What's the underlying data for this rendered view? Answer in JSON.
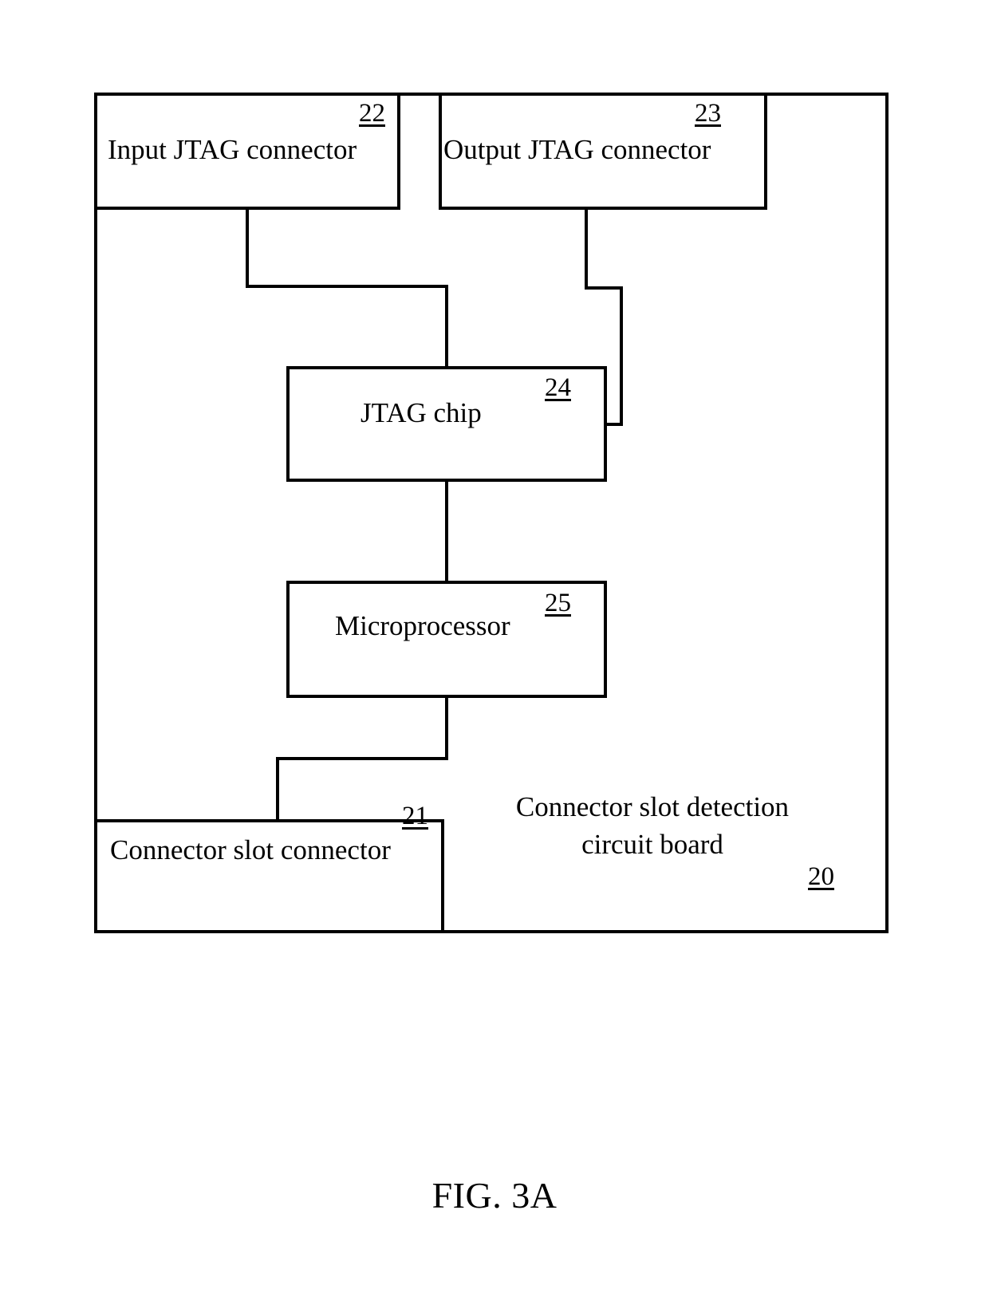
{
  "figure": {
    "caption": "FIG. 3A",
    "board": {
      "name_line1": "Connector slot detection",
      "name_line2": "circuit board",
      "ref": "20"
    },
    "blocks": [
      {
        "id": "input-jtag-connector",
        "label": "Input JTAG connector",
        "ref": "22"
      },
      {
        "id": "output-jtag-connector",
        "label": "Output JTAG connector",
        "ref": "23"
      },
      {
        "id": "jtag-chip",
        "label": "JTAG chip",
        "ref": "24"
      },
      {
        "id": "microprocessor",
        "label": "Microprocessor",
        "ref": "25"
      },
      {
        "id": "connector-slot-connector",
        "label": "Connector slot connector",
        "ref": "21"
      }
    ],
    "connections": [
      {
        "from": "input-jtag-connector",
        "to": "jtag-chip"
      },
      {
        "from": "output-jtag-connector",
        "to": "jtag-chip"
      },
      {
        "from": "jtag-chip",
        "to": "microprocessor"
      },
      {
        "from": "microprocessor",
        "to": "connector-slot-connector"
      }
    ],
    "colors": {
      "line": "#000000",
      "background": "#ffffff",
      "text": "#000000"
    }
  }
}
